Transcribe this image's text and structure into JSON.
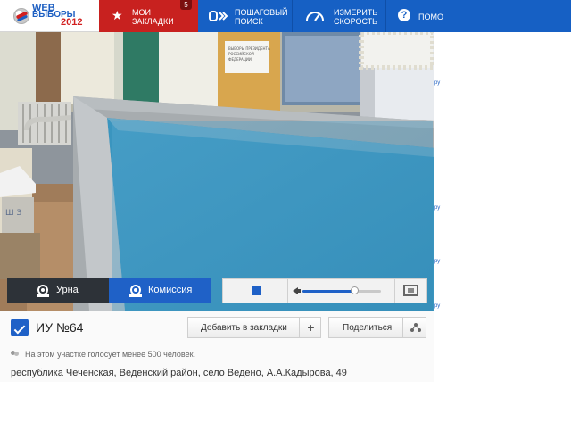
{
  "logo": {
    "line1": "WEB",
    "line2": "ВЫБОРЫ",
    "line3": "2012"
  },
  "nav": {
    "bookmarks": {
      "label": "Мои\nзакладки",
      "count": "5"
    },
    "search": {
      "label": "Пошаговый\nпоиск",
      "icon": "D»"
    },
    "speed": {
      "label": "Измерить\nскорость"
    },
    "help": {
      "label": "Помо",
      "icon": "?"
    }
  },
  "side_links": [
    "ру",
    "ру",
    "ру",
    "ру"
  ],
  "video": {
    "poster_text": "Выборы Президента Российской Федерации",
    "tabs": {
      "urna": "Урна",
      "komissia": "Комиссия"
    },
    "volume": 0.66
  },
  "station": {
    "title": "ИУ №64",
    "add_bookmark": "Добавить в закладки",
    "add_icon": "+",
    "share": "Поделиться",
    "voters_note": "На этом участке голосует менее 500 человек.",
    "address": "республика Чеченская, Веденский район, село Ведено, А.А.Кадырова, 49"
  },
  "colors": {
    "nav_blue": "#1660c4",
    "nav_red": "#c8211f",
    "accent": "#1f61c7"
  }
}
